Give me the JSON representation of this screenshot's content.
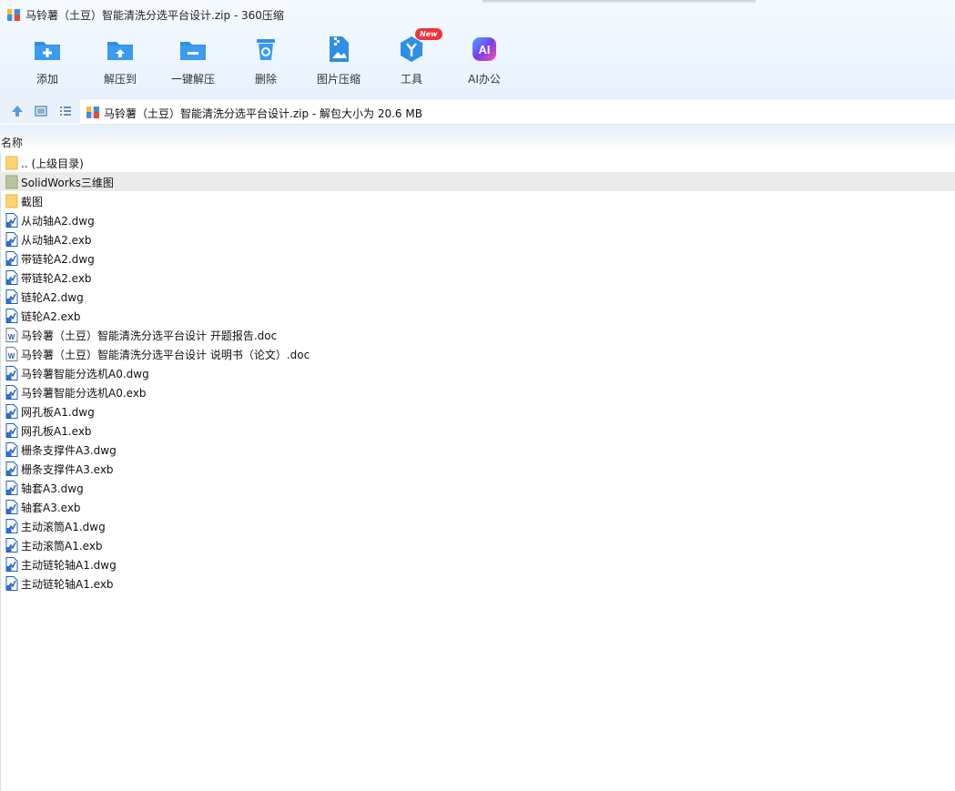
{
  "window": {
    "title": "马铃薯（土豆）智能清洗分选平台设计.zip - 360压缩"
  },
  "toolbar": [
    {
      "label": "添加",
      "icon": "add-icon",
      "color": "#2e8fe6"
    },
    {
      "label": "解压到",
      "icon": "extract-to-icon",
      "color": "#2e8fe6"
    },
    {
      "label": "一键解压",
      "icon": "one-click-extract-icon",
      "color": "#2e8fe6"
    },
    {
      "label": "删除",
      "icon": "delete-icon",
      "color": "#2e8fe6"
    },
    {
      "label": "图片压缩",
      "icon": "image-compress-icon",
      "color": "#2e8fe6"
    },
    {
      "label": "工具",
      "icon": "tools-icon",
      "color": "#2e8fe6",
      "badge": "New"
    },
    {
      "label": "AI办公",
      "icon": "ai-office-icon",
      "color": "#7a3cf0"
    }
  ],
  "address": {
    "text": "马铃薯（土豆）智能清洗分选平台设计.zip - 解包大小为 20.6 MB"
  },
  "columns": {
    "name": "名称"
  },
  "files": [
    {
      "name": ".. (上级目录)",
      "type": "folder",
      "selected": false
    },
    {
      "name": "SolidWorks三维图",
      "type": "folder-gray",
      "selected": true
    },
    {
      "name": "截图",
      "type": "folder",
      "selected": false
    },
    {
      "name": "从动轴A2.dwg",
      "type": "cad",
      "selected": false
    },
    {
      "name": "从动轴A2.exb",
      "type": "cad",
      "selected": false
    },
    {
      "name": "带链轮A2.dwg",
      "type": "cad",
      "selected": false
    },
    {
      "name": "带链轮A2.exb",
      "type": "cad",
      "selected": false
    },
    {
      "name": "链轮A2.dwg",
      "type": "cad",
      "selected": false
    },
    {
      "name": "链轮A2.exb",
      "type": "cad",
      "selected": false
    },
    {
      "name": "马铃薯（土豆）智能清洗分选平台设计 开题报告.doc",
      "type": "doc",
      "selected": false
    },
    {
      "name": "马铃薯（土豆）智能清洗分选平台设计 说明书（论文）.doc",
      "type": "doc",
      "selected": false
    },
    {
      "name": "马铃薯智能分选机A0.dwg",
      "type": "cad",
      "selected": false
    },
    {
      "name": "马铃薯智能分选机A0.exb",
      "type": "cad",
      "selected": false
    },
    {
      "name": "网孔板A1.dwg",
      "type": "cad",
      "selected": false
    },
    {
      "name": "网孔板A1.exb",
      "type": "cad",
      "selected": false
    },
    {
      "name": "栅条支撑件A3.dwg",
      "type": "cad",
      "selected": false
    },
    {
      "name": "栅条支撑件A3.exb",
      "type": "cad",
      "selected": false
    },
    {
      "name": "轴套A3.dwg",
      "type": "cad",
      "selected": false
    },
    {
      "name": "轴套A3.exb",
      "type": "cad",
      "selected": false
    },
    {
      "name": "主动滚筒A1.dwg",
      "type": "cad",
      "selected": false
    },
    {
      "name": "主动滚筒A1.exb",
      "type": "cad",
      "selected": false
    },
    {
      "name": "主动链轮轴A1.dwg",
      "type": "cad",
      "selected": false
    },
    {
      "name": "主动链轮轴A1.exb",
      "type": "cad",
      "selected": false
    }
  ]
}
